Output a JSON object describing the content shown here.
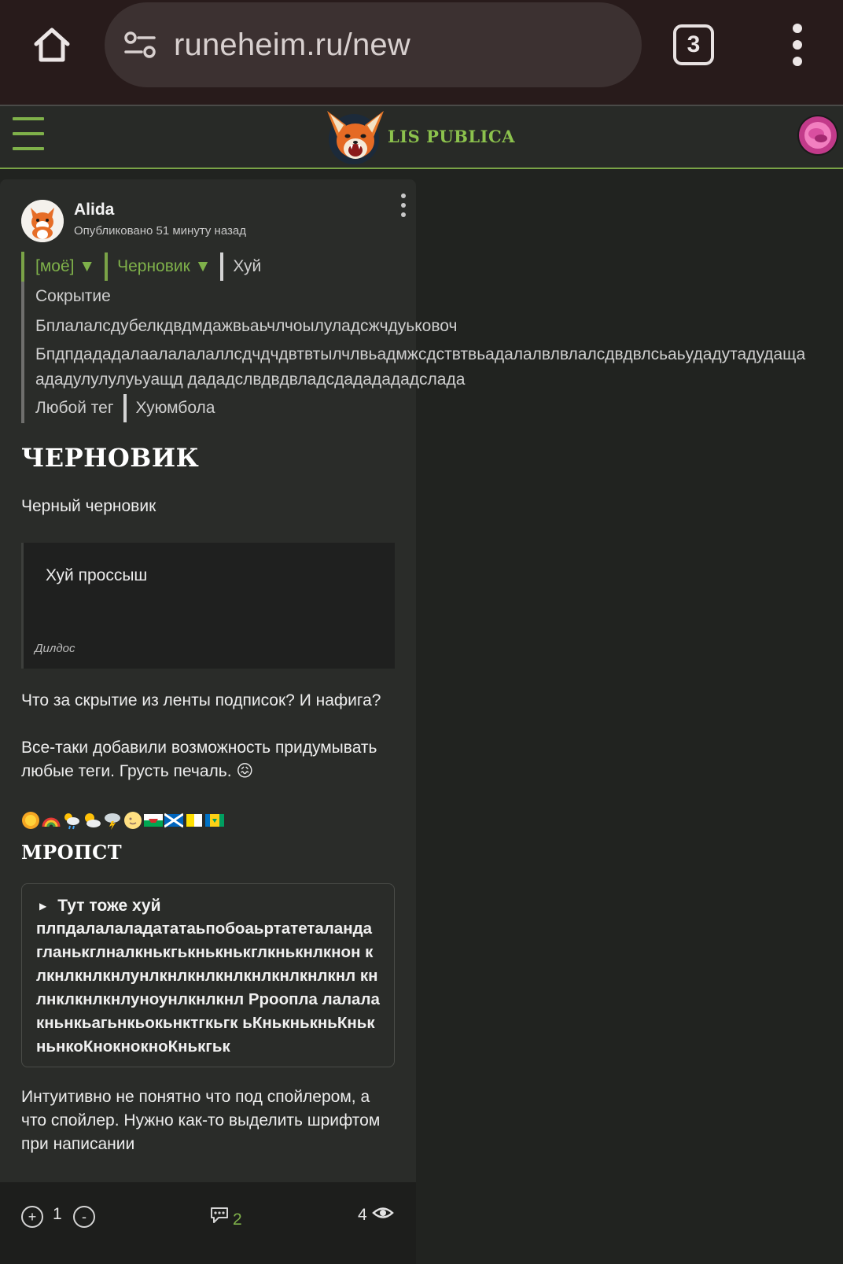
{
  "browser": {
    "url": "runeheim.ru/new",
    "tab_count": "3"
  },
  "site": {
    "brand": "LIS PUBLICA"
  },
  "post": {
    "author": "Alida",
    "published": "Опубликовано 51 минуту назад",
    "tags": {
      "row1": [
        "[моё] ▼",
        "Черновик ▼",
        "Хуй"
      ],
      "row2": "Сокрытие",
      "row3": "Бплалалсдубелкдвдмдажвьаьчлчоылуладсжчдуьковоч",
      "row4": "Бпдпдададалаалалалаллсдчдчдвтвтылчлвьадмжсдствтвьадалалвлвлалсдвдвлсьаьудадутадудаща ададулулулуьуащд дададслвдвдвладсдададададслада",
      "row5": [
        "Любой тег",
        "Хуюмбола"
      ]
    },
    "title": "ЧЕРНОВИК",
    "lead": "Черный черновик",
    "quote": {
      "text": "Хуй проссыш",
      "cite": "Дилдос"
    },
    "paragraph1": "Что за скрытие из ленты подписок? И нафига?",
    "paragraph2": "Все-таки добавили возможность придумывать любые теги. Грусть печаль. 😖",
    "emojis": [
      "sun-face-icon",
      "rainbow-icon",
      "sun-rain-cloud-icon",
      "sun-behind-cloud-icon",
      "thunder-cloud-icon",
      "moon-face-icon",
      "flag-wales-icon",
      "flag-scotland-icon",
      "flag-vatican-icon",
      "flag-saint-vincent-icon"
    ],
    "subheading": "МРОПСТ",
    "spoiler": {
      "summary": "Тут тоже хуй",
      "body": "плпдалалаладататаьпобоаьртатеталанда гланькглналкнькгькнькнькглкнькнлкнон клкнлкнлкнлунлкнлкнлкнлкнлкнлкнлкнл кнлнклкнлкнлуноунлкнлкнл Рроопла лалалакньнкьагьнкьокьнктгкьгк ьКнькнькньКнькньнкоКнокнокноКнькгьк"
    },
    "paragraph3": "Интуитивно не понятно что под спойлером, а что спойлер. Нужно как-то выделить шрифтом при написании",
    "votes": "1",
    "comments": "2",
    "views": "4",
    "vote_plus": "+",
    "vote_minus": "-"
  },
  "colors": {
    "accent_green": "#7fb14a",
    "background": "#212320",
    "card": "#2a2c29",
    "chrome": "#281b1b"
  }
}
